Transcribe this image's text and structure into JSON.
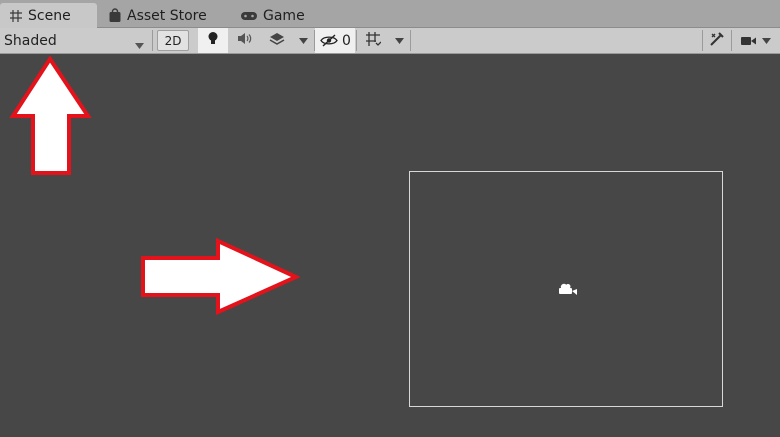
{
  "tabs": [
    {
      "label": "Scene",
      "icon": "grid-icon"
    },
    {
      "label": "Asset Store",
      "icon": "shopping-bag-icon"
    },
    {
      "label": "Game",
      "icon": "gamepad-icon"
    }
  ],
  "toolbar": {
    "draw_mode": "Shaded",
    "mode_2d_label": "2D",
    "hidden_count": "0"
  },
  "colors": {
    "scene_bg": "#474747",
    "tab_bar": "#a5a5a5",
    "toolbar": "#cbcbcb",
    "annotation_arrow_stroke": "#e3121b",
    "annotation_arrow_fill": "#ffffff"
  }
}
